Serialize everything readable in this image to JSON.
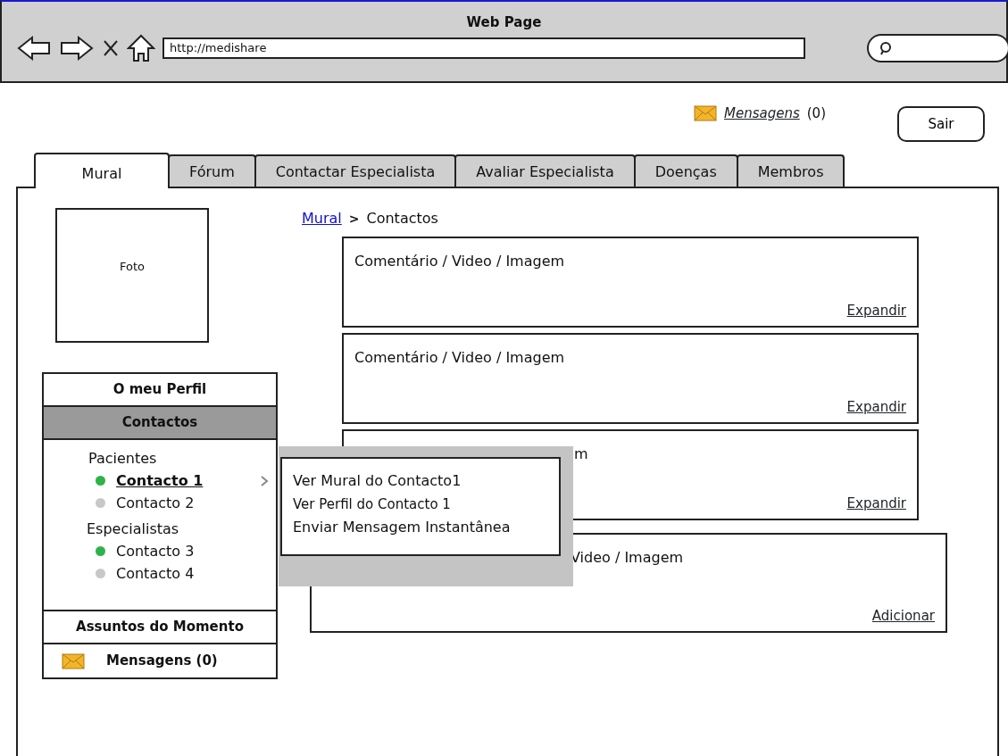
{
  "window": {
    "title": "Web Page"
  },
  "browser": {
    "url": "http://medishare"
  },
  "header": {
    "messages_link": "Mensagens",
    "messages_count": "(0)",
    "logout_button": "Sair"
  },
  "tabs": [
    {
      "label": "Mural",
      "selected": true
    },
    {
      "label": "Fórum",
      "selected": false
    },
    {
      "label": "Contactar Especialista",
      "selected": false
    },
    {
      "label": "Avaliar Especialista",
      "selected": false
    },
    {
      "label": "Doenças",
      "selected": false
    },
    {
      "label": "Membros",
      "selected": false
    }
  ],
  "photo": {
    "label": "Foto"
  },
  "sidebar": {
    "items": [
      {
        "label": "O meu Perfil",
        "kind": "plain",
        "selected": false
      },
      {
        "label": "Contactos",
        "kind": "plain",
        "selected": true,
        "groups": [
          {
            "label": "Pacientes",
            "contacts": [
              {
                "name": "Contacto 1",
                "selected": true,
                "color": "#2db34a"
              },
              {
                "name": "Contacto 2",
                "selected": false,
                "color": "#c8c8c8"
              }
            ]
          },
          {
            "label": "Especialistas",
            "contacts": [
              {
                "name": "Contacto 3",
                "selected": false,
                "color": "#2db34a"
              },
              {
                "name": "Contacto 4",
                "selected": false,
                "color": "#c8c8c8"
              }
            ]
          }
        ]
      },
      {
        "label": "Assuntos do Momento",
        "kind": "plain",
        "selected": false
      },
      {
        "label": "Mensagens (0)",
        "kind": "mail",
        "selected": false
      }
    ]
  },
  "breadcrumb": {
    "separator": ">",
    "items": [
      {
        "label": "Mural",
        "kind": "link"
      },
      {
        "label": "Contactos",
        "kind": "current"
      }
    ]
  },
  "posts": [
    {
      "kind": "post",
      "title": "Comentário / Video / Imagem",
      "action": "Expandir"
    },
    {
      "kind": "post",
      "title": "Comentário / Video / Imagem",
      "action": "Expandir"
    },
    {
      "kind": "post",
      "title": "m",
      "action": "Expandir"
    },
    {
      "kind": "new",
      "title": "Video / Imagem",
      "action": "Adicionar"
    }
  ],
  "context_menu": {
    "items": [
      "Ver Mural do Contacto1",
      "Ver Perfil do Contacto 1",
      "Enviar Mensagem Instantânea"
    ]
  }
}
